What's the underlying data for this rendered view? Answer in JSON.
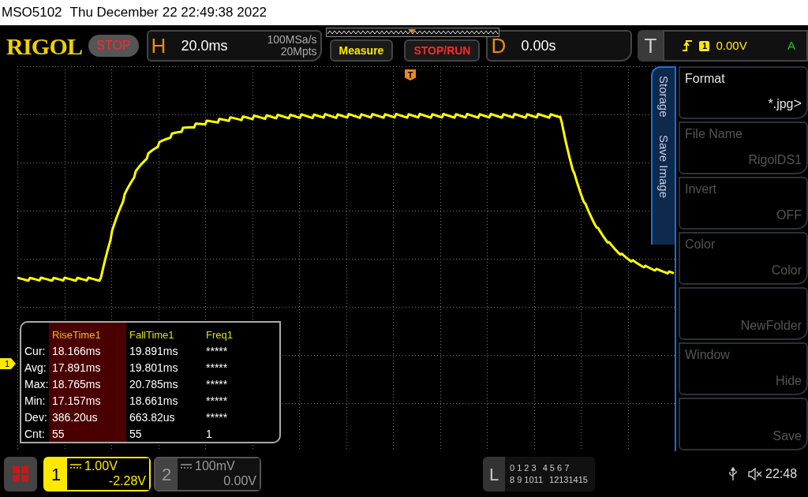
{
  "status_line": {
    "model": "MSO5102",
    "datetime": "Thu December 22 22:49:38 2022"
  },
  "toolbar": {
    "logo": "RIGOL",
    "run_state": "STOP",
    "horizontal": {
      "label": "H",
      "timebase": "20.0ms",
      "sample_rate": "100MSa/s",
      "memory_depth": "20Mpts"
    },
    "buttons": [
      {
        "label": "Measure",
        "kind": "measure"
      },
      {
        "label": "STOP/RUN",
        "kind": "run"
      }
    ],
    "delay": {
      "label": "D",
      "value": "0.00s"
    },
    "trigger": {
      "label": "T",
      "source": "1",
      "level": "0.00V",
      "mode": "A"
    }
  },
  "waveform": {
    "trigger_marker": "T",
    "channel_marker": "1"
  },
  "measurements": {
    "columns": [
      {
        "label": "RiseTime1",
        "selected": true
      },
      {
        "label": "FallTime1",
        "selected": false
      },
      {
        "label": "Freq1",
        "selected": false
      }
    ],
    "rows": [
      {
        "label": "Cur:",
        "values": [
          "18.166ms",
          "19.891ms",
          "*****"
        ]
      },
      {
        "label": "Avg:",
        "values": [
          "17.891ms",
          "19.801ms",
          "*****"
        ]
      },
      {
        "label": "Max:",
        "values": [
          "18.765ms",
          "20.785ms",
          "*****"
        ]
      },
      {
        "label": "Min:",
        "values": [
          "17.157ms",
          "18.661ms",
          "*****"
        ]
      },
      {
        "label": "Dev:",
        "values": [
          "386.20us",
          "663.82us",
          "*****"
        ]
      },
      {
        "label": "Cnt:",
        "values": [
          "55",
          "55",
          "1"
        ]
      }
    ]
  },
  "side_menu": {
    "tabs": [
      "Storage",
      "Save Image"
    ],
    "items": [
      {
        "label": "Format",
        "value": "*.jpg",
        "submenu": ">",
        "disabled": false
      },
      {
        "label": "File Name",
        "value": "RigolDS1",
        "disabled": true
      },
      {
        "label": "Invert",
        "value": "OFF",
        "disabled": true
      },
      {
        "label": "Color",
        "value": "Color",
        "disabled": true
      },
      {
        "value": "NewFolder",
        "disabled": true
      },
      {
        "label": "Window",
        "value": "Hide",
        "disabled": true
      },
      {
        "value": "Save",
        "disabled": true
      }
    ]
  },
  "channels": [
    {
      "number": "1",
      "scale": "1.00V",
      "offset": "-2.28V",
      "active": true
    },
    {
      "number": "2",
      "scale": "100mV",
      "offset": "0.00V",
      "active": false
    }
  ],
  "logic": {
    "label": "L",
    "rows": [
      [
        "0 1 2 3",
        "4 5 6 7"
      ],
      [
        "8 9 1011",
        "12131415"
      ]
    ]
  },
  "status": {
    "time": "22:48"
  }
}
